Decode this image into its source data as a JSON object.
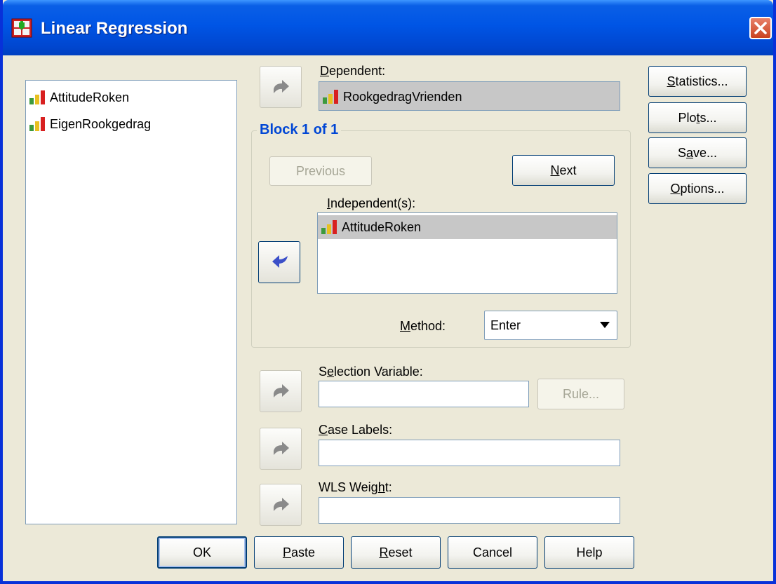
{
  "window": {
    "title": "Linear Regression",
    "icon": "regression-grid-icon",
    "close_icon": "close-icon"
  },
  "source_list": {
    "items": [
      "AttitudeRoken",
      "EigenRookgedrag"
    ],
    "item_icon": "scale-variable-icon"
  },
  "dependent": {
    "label": "Dependent:",
    "value": "RookgedragVrienden"
  },
  "block": {
    "title": "Block 1 of 1",
    "previous_label": "Previous",
    "next_label": "Next",
    "independents_label": "Independent(s):",
    "independents": [
      "AttitudeRoken"
    ],
    "method_label": "Method:",
    "method_value": "Enter"
  },
  "selection_variable": {
    "label": "Selection Variable:",
    "value": "",
    "rule_label": "Rule..."
  },
  "case_labels": {
    "label": "Case Labels:",
    "value": ""
  },
  "wls_weight": {
    "label": "WLS Weight:",
    "value": ""
  },
  "side_buttons": {
    "statistics": "Statistics...",
    "plots": "Plots...",
    "save": "Save...",
    "options": "Options..."
  },
  "bottom_buttons": {
    "ok": "OK",
    "paste": "Paste",
    "reset": "Reset",
    "cancel": "Cancel",
    "help": "Help"
  },
  "colors": {
    "title_bar": "#0055e5",
    "dialog_bg": "#ece9d8",
    "block_title": "#0046d5",
    "selected_row": "#c7c7c7"
  }
}
